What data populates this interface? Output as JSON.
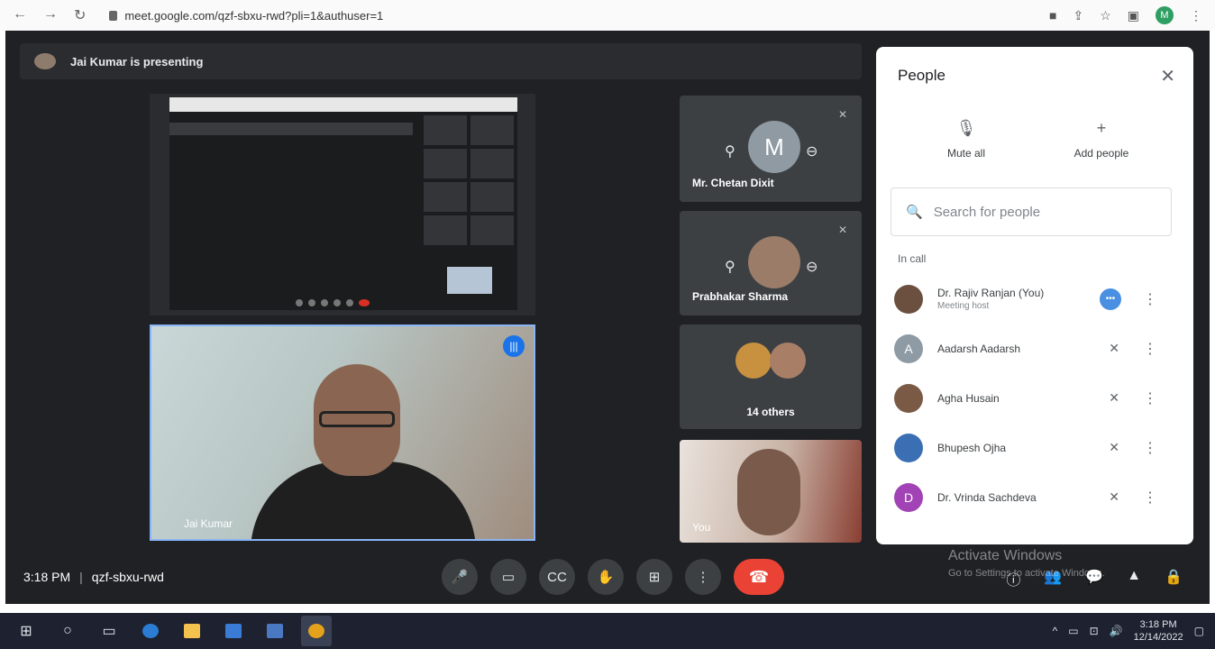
{
  "browser": {
    "url": "meet.google.com/qzf-sbxu-rwd?pli=1&authuser=1",
    "profile_initial": "M"
  },
  "meet": {
    "presenting_banner": "Jai Kumar is presenting",
    "speaker_name": "Jai Kumar",
    "tiles": {
      "chetan": {
        "name": "Mr. Chetan Dixit",
        "avatar_letter": "M"
      },
      "prabhakar": {
        "name": "Prabhakar Sharma"
      },
      "others": {
        "label": "14 others"
      },
      "you": {
        "label": "You"
      }
    },
    "time": "3:18 PM",
    "meeting_code": "qzf-sbxu-rwd"
  },
  "people": {
    "title": "People",
    "mute_all": "Mute all",
    "add_people": "Add people",
    "search_placeholder": "Search for people",
    "section": "In call",
    "participants": [
      {
        "name": "Dr. Rajiv Ranjan (You)",
        "sub": "Meeting host",
        "initial": "",
        "color": "#6b4f3f"
      },
      {
        "name": "Aadarsh Aadarsh",
        "sub": "",
        "initial": "A",
        "color": "#8e9aa4"
      },
      {
        "name": "Agha Husain",
        "sub": "",
        "initial": "",
        "color": "#7b5a45"
      },
      {
        "name": "Bhupesh Ojha",
        "sub": "",
        "initial": "",
        "color": "#3b6fb3"
      },
      {
        "name": "Dr. Vrinda Sachdeva",
        "sub": "",
        "initial": "D",
        "color": "#a142b5"
      }
    ]
  },
  "watermark": {
    "title": "Activate Windows",
    "sub": "Go to Settings to activate Windows."
  },
  "taskbar": {
    "time": "3:18 PM",
    "date": "12/14/2022"
  }
}
